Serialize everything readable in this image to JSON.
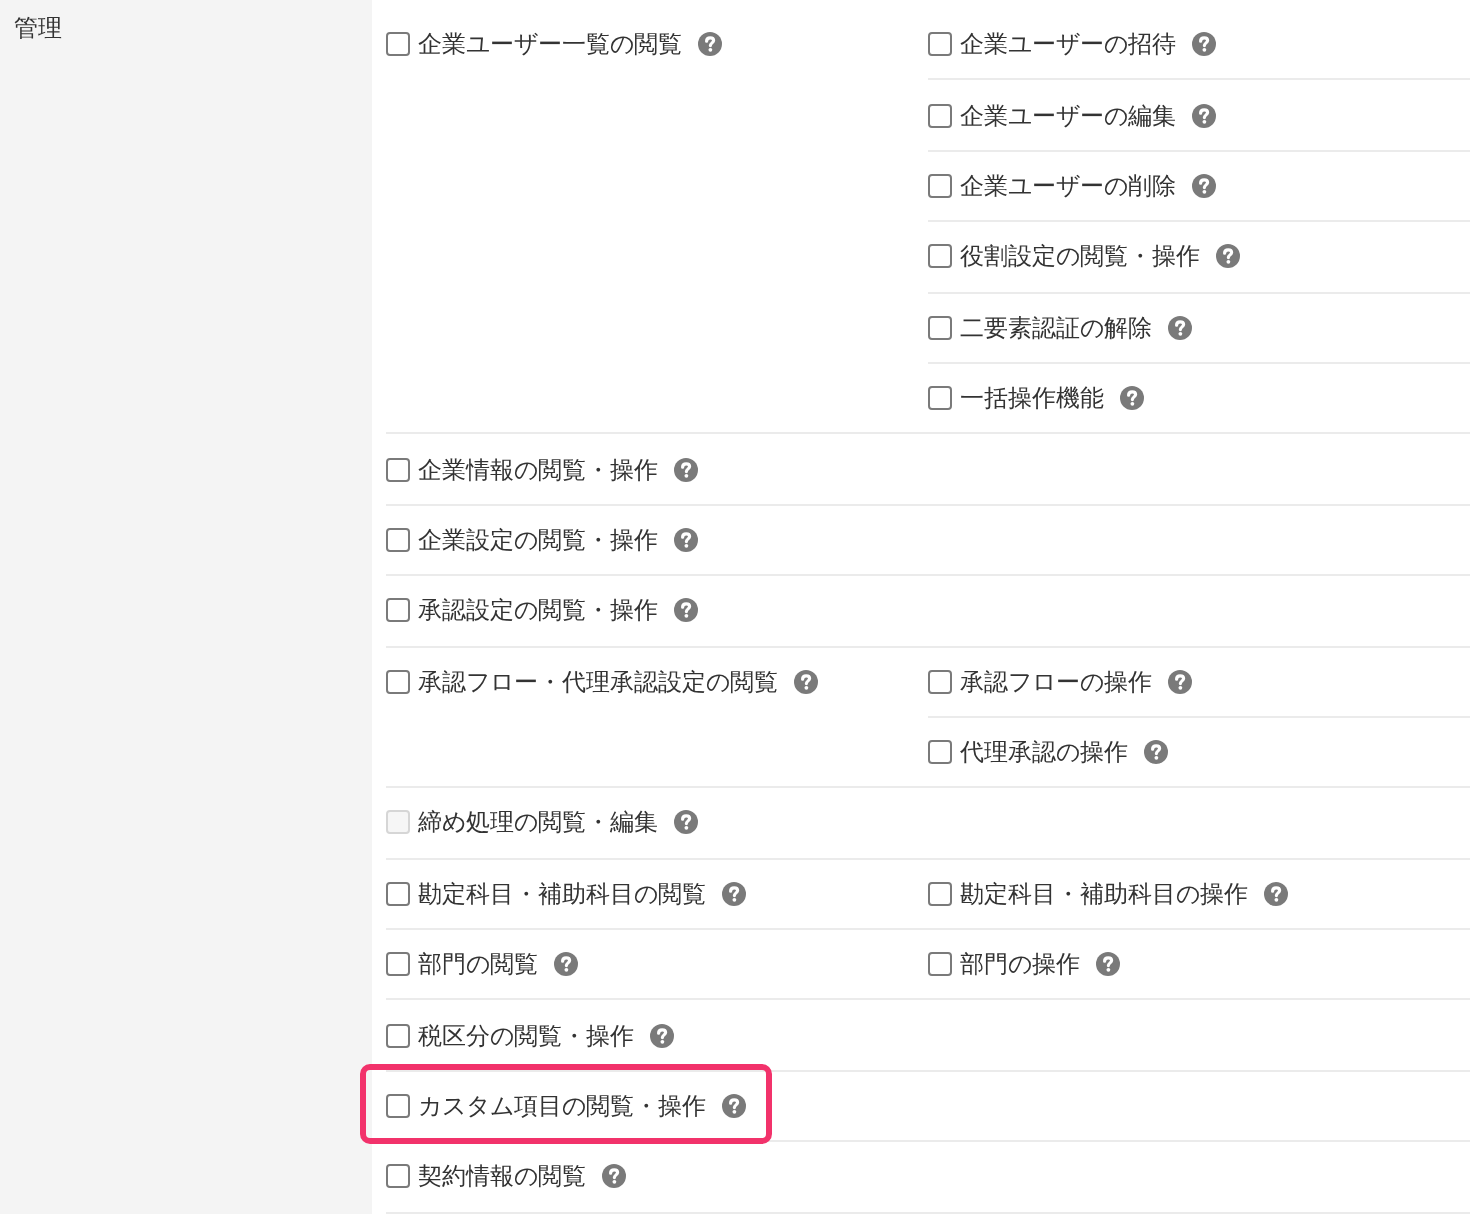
{
  "sidebar": {
    "label": "管理"
  },
  "groups": [
    {
      "main": {
        "label": "企業ユーザー一覧の閲覧",
        "checked": false,
        "disabled": false,
        "highlighted": false
      },
      "related": [
        {
          "label": "企業ユーザーの招待",
          "checked": false,
          "disabled": false
        },
        {
          "label": "企業ユーザーの編集",
          "checked": false,
          "disabled": false
        },
        {
          "label": "企業ユーザーの削除",
          "checked": false,
          "disabled": false
        },
        {
          "label": "役割設定の閲覧・操作",
          "checked": false,
          "disabled": false
        },
        {
          "label": "二要素認証の解除",
          "checked": false,
          "disabled": false
        },
        {
          "label": "一括操作機能",
          "checked": false,
          "disabled": false
        }
      ]
    },
    {
      "main": {
        "label": "企業情報の閲覧・操作",
        "checked": false,
        "disabled": false,
        "highlighted": false
      }
    },
    {
      "main": {
        "label": "企業設定の閲覧・操作",
        "checked": false,
        "disabled": false,
        "highlighted": false
      }
    },
    {
      "main": {
        "label": "承認設定の閲覧・操作",
        "checked": false,
        "disabled": false,
        "highlighted": false
      }
    },
    {
      "main": {
        "label": "承認フロー・代理承認設定の閲覧",
        "checked": false,
        "disabled": false,
        "highlighted": false
      },
      "related": [
        {
          "label": "承認フローの操作",
          "checked": false,
          "disabled": false
        },
        {
          "label": "代理承認の操作",
          "checked": false,
          "disabled": false
        }
      ]
    },
    {
      "main": {
        "label": "締め処理の閲覧・編集",
        "checked": false,
        "disabled": true,
        "highlighted": false
      }
    },
    {
      "main": {
        "label": "勘定科目・補助科目の閲覧",
        "checked": false,
        "disabled": false,
        "highlighted": false
      },
      "related": [
        {
          "label": "勘定科目・補助科目の操作",
          "checked": false,
          "disabled": false
        }
      ]
    },
    {
      "main": {
        "label": "部門の閲覧",
        "checked": false,
        "disabled": false,
        "highlighted": false
      },
      "related": [
        {
          "label": "部門の操作",
          "checked": false,
          "disabled": false
        }
      ]
    },
    {
      "main": {
        "label": "税区分の閲覧・操作",
        "checked": false,
        "disabled": false,
        "highlighted": false
      }
    },
    {
      "main": {
        "label": "カスタム項目の閲覧・操作",
        "checked": false,
        "disabled": false,
        "highlighted": true
      }
    },
    {
      "main": {
        "label": "契約情報の閲覧",
        "checked": false,
        "disabled": false,
        "highlighted": false
      }
    }
  ]
}
